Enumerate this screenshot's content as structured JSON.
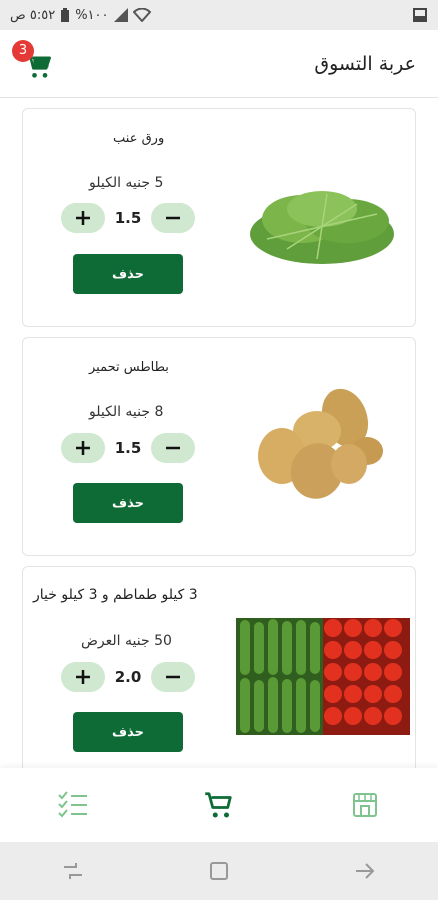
{
  "status_bar": {
    "time": "٥:٥٢ ص",
    "battery": "%١٠٠"
  },
  "header": {
    "title": "عربة التسوق",
    "cart_count": "3"
  },
  "cart_items": [
    {
      "name": "ورق عنب",
      "price": "5 جنيه الكيلو",
      "quantity": "1.5",
      "delete_label": "حذف",
      "image": "grape-leaves-image"
    },
    {
      "name": "بطاطس تحمير",
      "price": "8 جنيه الكيلو",
      "quantity": "1.5",
      "delete_label": "حذف",
      "image": "potatoes-image"
    },
    {
      "name": "3 كيلو طماطم و 3 كيلو خيار",
      "price": "50 جنيه العرض",
      "quantity": "2.0",
      "delete_label": "حذف",
      "image": "tomatoes-cucumbers-image"
    }
  ],
  "bottom_nav": {
    "items": [
      "orders-list-icon",
      "cart-icon",
      "store-icon"
    ]
  },
  "colors": {
    "primary": "#0e6b35",
    "qty_button_bg": "#cfe8cf",
    "badge": "#e53935"
  }
}
